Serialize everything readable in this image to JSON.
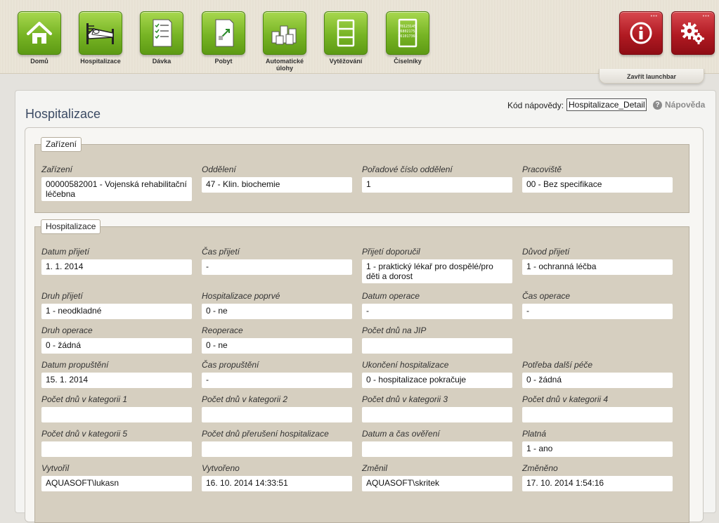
{
  "launchbar": {
    "items": [
      {
        "label": "Domů",
        "icon": "home-icon"
      },
      {
        "label": "Hospitalizace",
        "icon": "bed-icon"
      },
      {
        "label": "Dávka",
        "icon": "batch-document-icon"
      },
      {
        "label": "Pobyt",
        "icon": "stay-document-icon"
      },
      {
        "label": "Automatické úlohy",
        "icon": "automatic-tasks-icon"
      },
      {
        "label": "Vytěžování",
        "icon": "extraction-icon"
      },
      {
        "label": "Číselníky",
        "icon": "codebook-icon"
      }
    ],
    "codebook_icon_text": [
      "78123145",
      "968021755",
      "661017366"
    ],
    "close_label": "Zavřít launchbar",
    "accent_green": "#77b424",
    "accent_red": "#b11a22"
  },
  "page": {
    "title": "Hospitalizace",
    "help_code_label": "Kód nápovědy:",
    "help_code_value": "Hospitalizace_Detail",
    "help_link": "Nápověda"
  },
  "zarizeni": {
    "legend": "Zařízení",
    "fields": [
      {
        "label": "Zařízení",
        "value": "00000582001 - Vojenská rehabilitační léčebna"
      },
      {
        "label": "Oddělení",
        "value": "47 - Klin. biochemie"
      },
      {
        "label": "Pořadové číslo oddělení",
        "value": "1"
      },
      {
        "label": "Pracoviště",
        "value": "00 - Bez specifikace"
      }
    ]
  },
  "hospitalizace": {
    "legend": "Hospitalizace",
    "rows": [
      [
        {
          "label": "Datum přijetí",
          "value": "1. 1. 2014"
        },
        {
          "label": "Čas přijetí",
          "value": "-"
        },
        {
          "label": "Přijetí doporučil",
          "value": "1 - praktický lékař pro dospělé/pro děti a dorost"
        },
        {
          "label": "Důvod přijetí",
          "value": "1 - ochranná léčba"
        }
      ],
      [
        {
          "label": "Druh přijetí",
          "value": "1 - neodkladné"
        },
        {
          "label": "Hospitalizace poprvé",
          "value": "0 - ne"
        },
        {
          "label": "Datum operace",
          "value": "-"
        },
        {
          "label": "Čas operace",
          "value": "-"
        }
      ],
      [
        {
          "label": "Druh operace",
          "value": "0 - žádná"
        },
        {
          "label": "Reoperace",
          "value": "0 - ne"
        },
        {
          "label": "Počet dnů na JIP",
          "value": ""
        }
      ],
      [
        {
          "label": "Datum propuštění",
          "value": "15. 1. 2014"
        },
        {
          "label": "Čas propuštění",
          "value": "-"
        },
        {
          "label": "Ukončení hospitalizace",
          "value": "0 - hospitalizace pokračuje"
        },
        {
          "label": "Potřeba další péče",
          "value": "0 - žádná"
        }
      ],
      [
        {
          "label": "Počet dnů v kategorii 1",
          "value": ""
        },
        {
          "label": "Počet dnů v kategorii 2",
          "value": ""
        },
        {
          "label": "Počet dnů v kategorii 3",
          "value": ""
        },
        {
          "label": "Počet dnů v kategorii 4",
          "value": ""
        }
      ],
      [
        {
          "label": "Počet dnů v kategorii 5",
          "value": ""
        },
        {
          "label": "Počet dnů přerušení hospitalizace",
          "value": ""
        },
        {
          "label": "Datum a čas ověření",
          "value": ""
        },
        {
          "label": "Platná",
          "value": "1 - ano"
        }
      ],
      [
        {
          "label": "Vytvořil",
          "value": "AQUASOFT\\lukasn"
        },
        {
          "label": "Vytvořeno",
          "value": "16. 10. 2014 14:33:51"
        },
        {
          "label": "Změnil",
          "value": "AQUASOFT\\skritek"
        },
        {
          "label": "Změněno",
          "value": "17. 10. 2014 1:54:16"
        }
      ]
    ]
  }
}
